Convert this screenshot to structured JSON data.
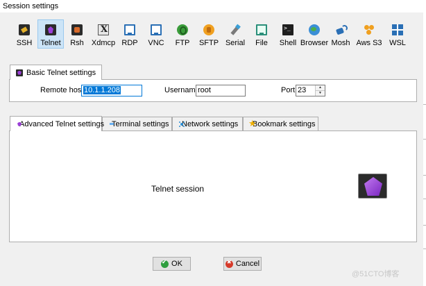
{
  "window": {
    "title": "Session settings"
  },
  "protocols": [
    {
      "label": "SSH",
      "icon": "ssh-icon"
    },
    {
      "label": "Telnet",
      "icon": "telnet-icon",
      "selected": true
    },
    {
      "label": "Rsh",
      "icon": "rsh-icon"
    },
    {
      "label": "Xdmcp",
      "icon": "xdmcp-icon"
    },
    {
      "label": "RDP",
      "icon": "rdp-icon"
    },
    {
      "label": "VNC",
      "icon": "vnc-icon"
    },
    {
      "label": "FTP",
      "icon": "ftp-icon"
    },
    {
      "label": "SFTP",
      "icon": "sftp-icon"
    },
    {
      "label": "Serial",
      "icon": "serial-icon"
    },
    {
      "label": "File",
      "icon": "file-icon"
    },
    {
      "label": "Shell",
      "icon": "shell-icon"
    },
    {
      "label": "Browser",
      "icon": "browser-icon"
    },
    {
      "label": "Mosh",
      "icon": "mosh-icon"
    },
    {
      "label": "Aws S3",
      "icon": "aws-s3-icon"
    },
    {
      "label": "WSL",
      "icon": "wsl-icon"
    }
  ],
  "basic": {
    "tab_label": "Basic Telnet settings",
    "remote_host_label": "Remote host *",
    "remote_host_value": "10.1.1.208",
    "username_label": "Username",
    "username_value": "root",
    "port_label": "Port",
    "port_value": "23"
  },
  "advanced_tabs": [
    {
      "label": "Advanced Telnet settings",
      "icon": "telnet-icon"
    },
    {
      "label": "Terminal settings",
      "icon": "terminal-icon"
    },
    {
      "label": "Network settings",
      "icon": "network-icon"
    },
    {
      "label": "Bookmark settings",
      "icon": "star-icon"
    }
  ],
  "panel": {
    "session_label": "Telnet session",
    "icon": "telnet-icon"
  },
  "buttons": {
    "ok": "OK",
    "cancel": "Cancel"
  },
  "watermark": "@51CTO博客",
  "colors": {
    "selection": "#0078d7",
    "selected_tab_bg": "#cce4f7",
    "telnet_purple": "#9b3fd8"
  }
}
